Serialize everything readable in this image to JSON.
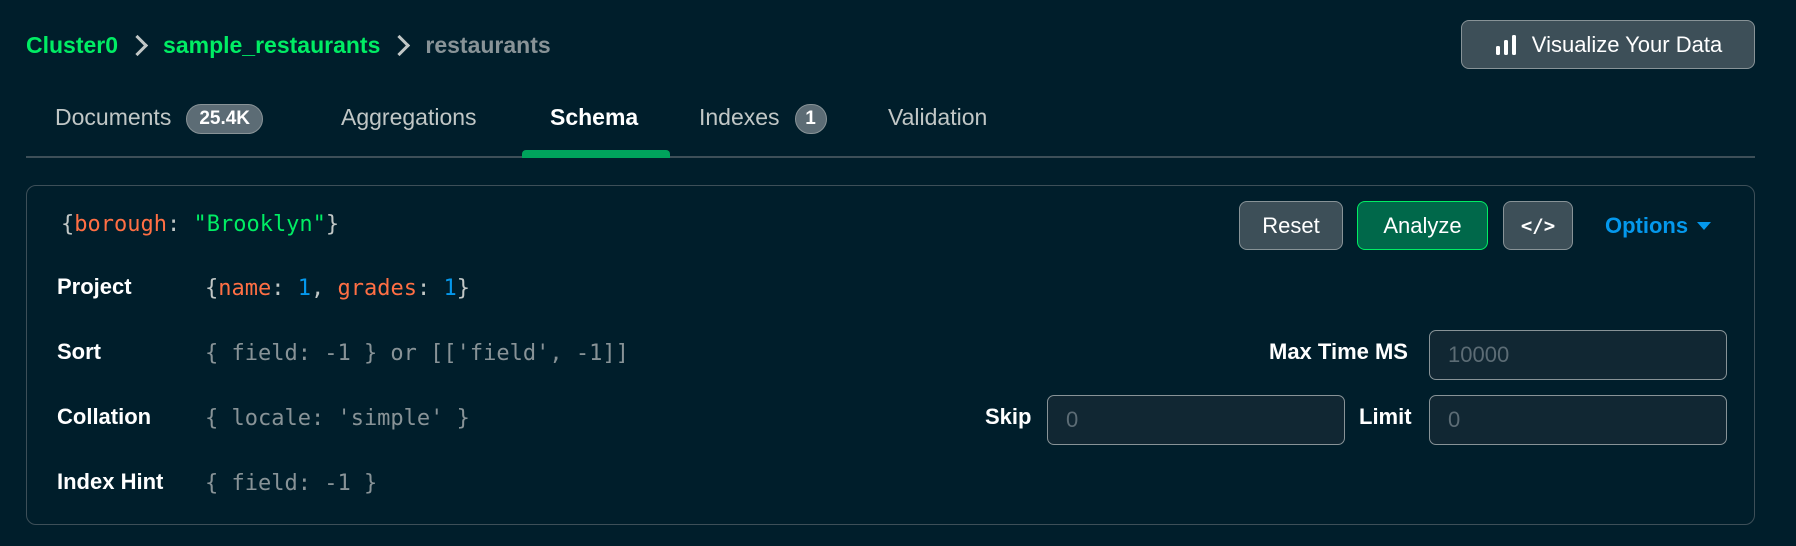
{
  "breadcrumb": {
    "cluster": "Cluster0",
    "database": "sample_restaurants",
    "collection": "restaurants"
  },
  "visualize_button": {
    "label": "Visualize Your Data",
    "icon": "bar-chart-icon"
  },
  "tabs": [
    {
      "label": "Documents",
      "badge": "25.4K",
      "active": false
    },
    {
      "label": "Aggregations",
      "active": false
    },
    {
      "label": "Schema",
      "active": true
    },
    {
      "label": "Indexes",
      "badge": "1",
      "active": false
    },
    {
      "label": "Validation",
      "active": false
    }
  ],
  "query_bar": {
    "filter": {
      "open": "{",
      "key": "borough",
      "colon": ": ",
      "value": "\"Brooklyn\"",
      "close": "}"
    },
    "buttons": {
      "reset": "Reset",
      "analyze": "Analyze",
      "code": "</>",
      "options": "Options"
    },
    "project": {
      "label": "Project",
      "open": "{",
      "key1": "name",
      "val1": "1",
      "sep": ", ",
      "key2": "grades",
      "val2": "1",
      "colon": ": ",
      "close": "}"
    },
    "sort": {
      "label": "Sort",
      "placeholder": "{ field: -1 } or [['field', -1]]"
    },
    "collation": {
      "label": "Collation",
      "placeholder": "{ locale: 'simple' }"
    },
    "index_hint": {
      "label": "Index Hint",
      "placeholder": "{ field: -1 }"
    },
    "max_time_ms": {
      "label": "Max Time MS",
      "placeholder": "10000"
    },
    "skip": {
      "label": "Skip",
      "placeholder": "0"
    },
    "limit": {
      "label": "Limit",
      "placeholder": "0"
    }
  },
  "colors": {
    "background": "#001e2b",
    "brand_green": "#00ed64",
    "link_blue": "#0498ec",
    "key_orange": "#ff6f44"
  }
}
